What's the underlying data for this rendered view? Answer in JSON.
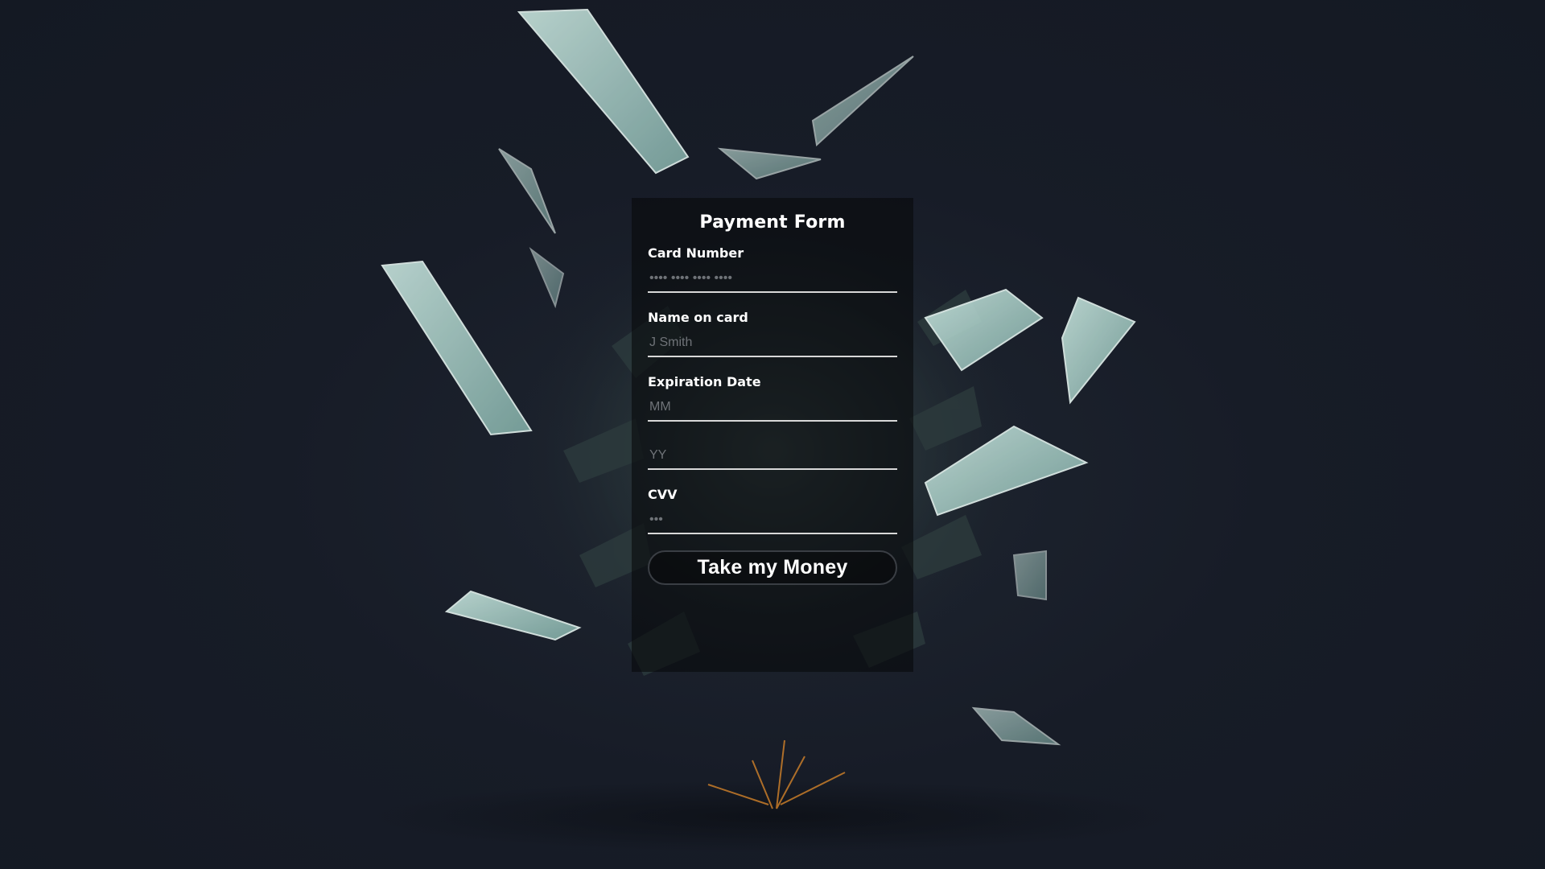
{
  "form": {
    "title": "Payment Form",
    "button_label": "Take my Money"
  },
  "fields": {
    "card_number": {
      "label": "Card Number",
      "value": "",
      "placeholder": "•••• •••• •••• ••••"
    },
    "name_on_card": {
      "label": "Name on card",
      "value": "",
      "placeholder": "J Smith"
    },
    "expiration": {
      "label": "Expiration Date",
      "month_placeholder": "MM",
      "year_placeholder": "YY"
    },
    "cvv": {
      "label": "CVV",
      "value": "",
      "placeholder": "•••"
    }
  },
  "background": {
    "subject": "exploding-money-illustration",
    "colors": {
      "base": "#161b26",
      "bill": "#a9cfc8",
      "spark": "#e08a2a"
    }
  }
}
